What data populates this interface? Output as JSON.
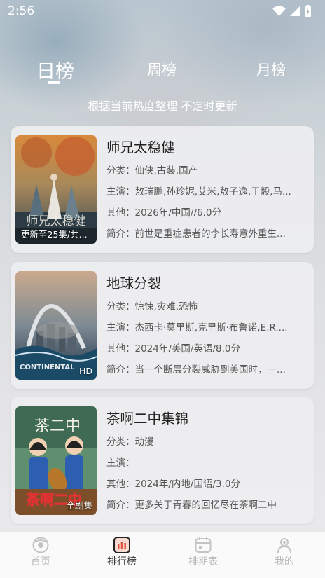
{
  "status_bar": {
    "time": "2:56"
  },
  "tabs": {
    "day": "日榜",
    "week": "周榜",
    "month": "月榜",
    "selected": "日榜"
  },
  "subtitle": "根据当前热度整理 不定时更新",
  "cards": [
    {
      "title": "师兄太稳健",
      "category": "分类：仙侠,古装,国产",
      "cast": "主演：敖瑞鹏,孙珍妮,艾米,敖子逸,于毅,马...",
      "other": "其他：2026年/中国//6.0分",
      "summary": "简介：前世是重症患者的李长寿意外重生...",
      "badge": "更新至25集/共..."
    },
    {
      "title": "地球分裂",
      "category": "分类：惊悚,灾难,恐怖",
      "cast": "主演：杰西卡·莫里斯,克里斯·布鲁诺,E.R....",
      "other": "其他：2024年/美国/英语/8.0分",
      "summary": "简介：当一个断层分裂威胁到美国时，一...",
      "badge": "HD"
    },
    {
      "title": "茶啊二中集锦",
      "category": "分类：动漫",
      "cast": "主演：",
      "other": "其他：2024年/内地/国语/3.0分",
      "summary": "简介：更多关于青春的回忆尽在茶啊二中",
      "badge": "全剧集"
    }
  ],
  "nav": {
    "home": "首页",
    "ranking": "排行榜",
    "schedule": "排期表",
    "mine": "我的",
    "active": "排行榜"
  }
}
